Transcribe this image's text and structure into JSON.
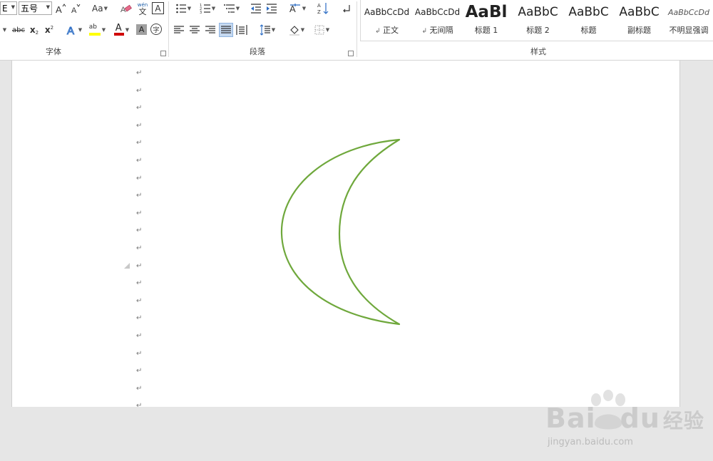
{
  "font_group": {
    "label": "字体",
    "font_name_value": "E",
    "font_size_value": "五号",
    "change_case_label": "Aa",
    "phonetic_label": "wén",
    "phonetic_char": "文",
    "border_char": "A",
    "strike_label": "abc",
    "subscript_label": "x",
    "subscript_sub": "2",
    "superscript_label": "x",
    "superscript_sup": "2",
    "highlight_label": "ab",
    "font_color_label": "A",
    "shade_char": "A",
    "circle_char": "字"
  },
  "paragraph_group": {
    "label": "段落"
  },
  "styles_group": {
    "label": "样式",
    "items": [
      {
        "sample": "AaBbCcDd",
        "name": "正文",
        "mark": "↲"
      },
      {
        "sample": "AaBbCcDd",
        "name": "无间隔",
        "mark": "↲"
      },
      {
        "sample": "AaBl",
        "name": "标题 1"
      },
      {
        "sample": "AaBbC",
        "name": "标题 2"
      },
      {
        "sample": "AaBbC",
        "name": "标题"
      },
      {
        "sample": "AaBbC",
        "name": "副标题"
      },
      {
        "sample": "AaBbCcDd",
        "name": "不明显强调"
      }
    ]
  },
  "document": {
    "paragraph_mark": "↵",
    "shape": {
      "type": "moon",
      "outline_color": "#6fa83c"
    }
  },
  "colors": {
    "highlight_bar": "#ffff00",
    "font_color_bar": "#d00000",
    "justify_selected": "#c5d9f1"
  },
  "watermark": {
    "brand": "Bai",
    "brand2": "du",
    "brand_cn": "经验",
    "url": "jingyan.baidu.com"
  }
}
